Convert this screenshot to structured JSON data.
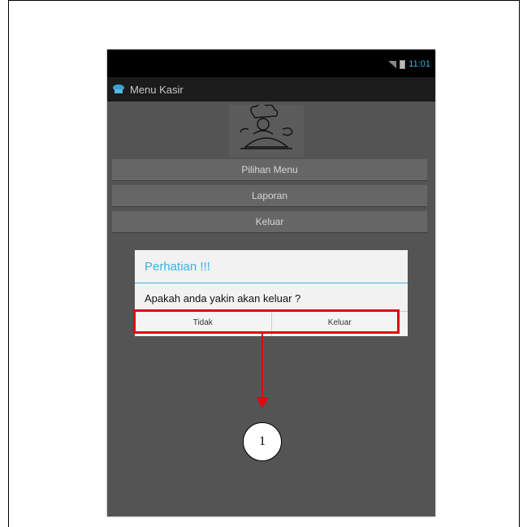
{
  "status_bar": {
    "time": "11:01"
  },
  "action_bar": {
    "title": "Menu Kasir",
    "icon": "cashier-app-icon"
  },
  "content": {
    "logo": "chef-icon",
    "menu_buttons": [
      "Pilihan Menu",
      "Laporan",
      "Keluar"
    ]
  },
  "dialog": {
    "title": "Perhatian !!!",
    "message": "Apakah anda yakin akan keluar ?",
    "buttons": [
      "Tidak",
      "Keluar"
    ],
    "accent_color": "#33b5e5"
  },
  "annotation": {
    "callout_number": "1",
    "highlight_color": "#e30613"
  }
}
